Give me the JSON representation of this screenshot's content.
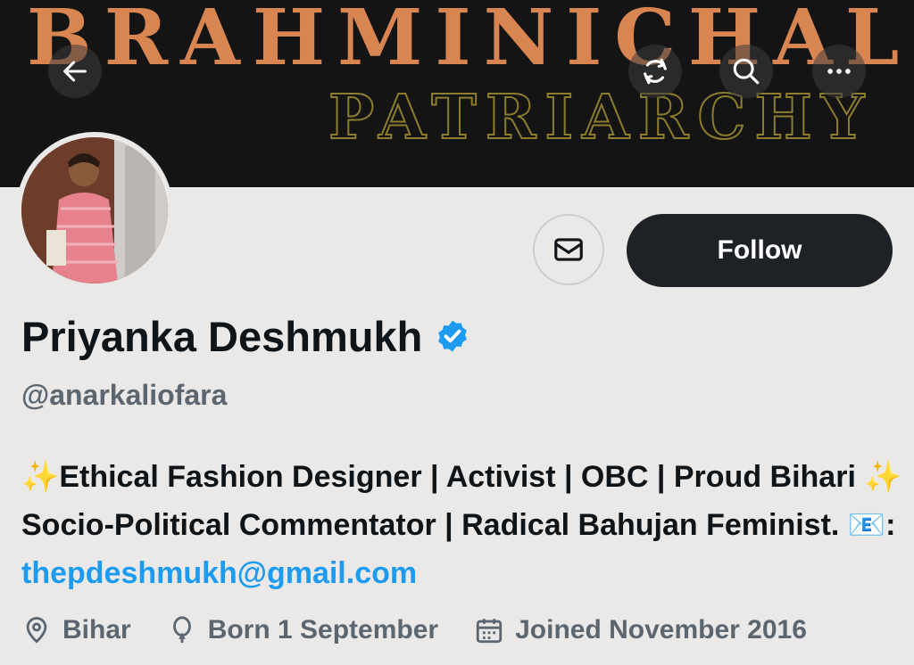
{
  "banner": {
    "line1": "BRAHMINICHAL",
    "line2": "PATRIARCHY",
    "colors": {
      "line1": "#d98552",
      "line2": "#8c7d2e",
      "background": "#141414"
    }
  },
  "nav": {
    "back_icon": "arrow-left-icon",
    "refresh_icon": "refresh-icon",
    "search_icon": "search-icon",
    "more_icon": "more-icon"
  },
  "profile": {
    "name": "Priyanka Deshmukh",
    "handle": "@anarkaliofara",
    "verified": true
  },
  "actions": {
    "message_icon": "mail-icon",
    "follow_label": "Follow"
  },
  "bio": {
    "part1": "Ethical Fashion Designer | Activist | OBC | Proud Bihari ",
    "part2": " Socio-Political Commentator | Radical Bahujan Feminist. ",
    "part3": ": ",
    "email": "thepdeshmukh@gmail.com"
  },
  "meta": {
    "location": "Bihar",
    "birthday": "Born 1 September",
    "joined": "Joined November 2016"
  },
  "colors": {
    "accent": "#1d9bf0",
    "follow_bg": "#1e2226",
    "muted": "#5b6670"
  }
}
